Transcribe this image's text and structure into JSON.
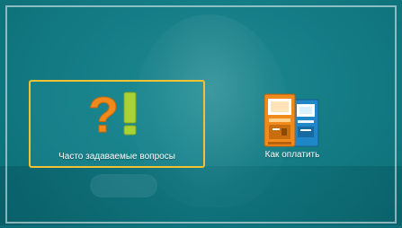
{
  "menu": {
    "items": [
      {
        "label": "Часто задаваемые вопросы",
        "icon": "question-exclamation-icon",
        "selected": true
      },
      {
        "label": "Как оплатить",
        "icon": "payment-kiosk-icon",
        "selected": false
      }
    ]
  },
  "colors": {
    "background": "#147c85",
    "selection_border": "#f2c233",
    "question_mark": "#f08a1c",
    "exclamation_mark": "#a8d236",
    "kiosk_orange": "#f08a1c",
    "kiosk_blue": "#1f86c8"
  }
}
